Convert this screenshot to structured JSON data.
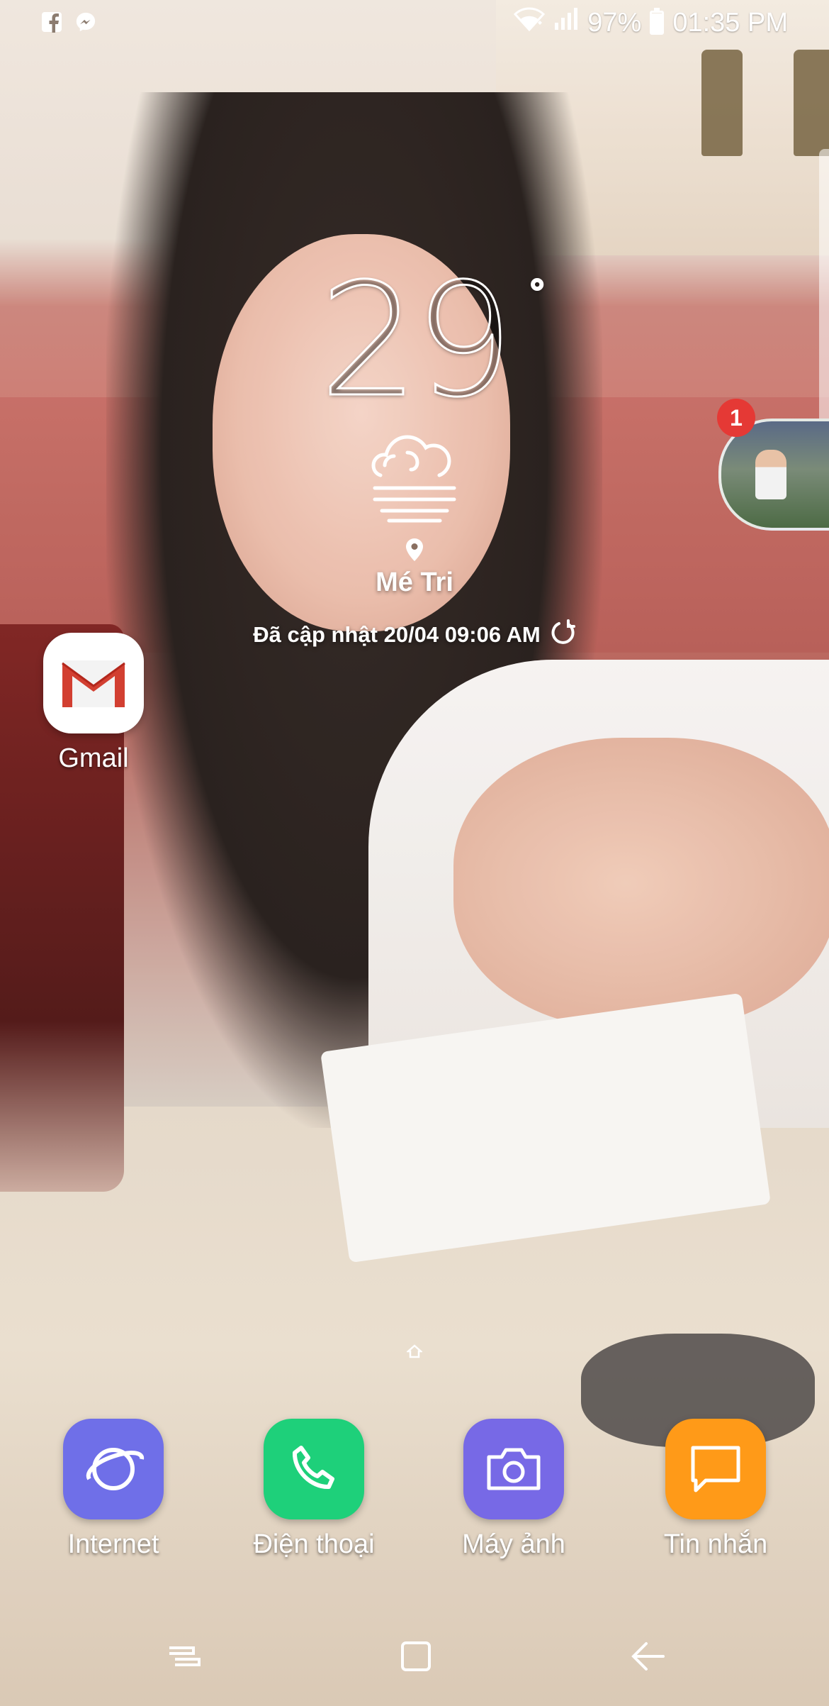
{
  "status_bar": {
    "notification_icons": [
      "facebook-icon",
      "messenger-icon"
    ],
    "signal_icons": [
      "wifi-icon",
      "cellular-signal-icon"
    ],
    "battery_percent": "97%",
    "battery_level": 0.97,
    "time": "01:35 PM"
  },
  "weather_widget": {
    "temperature": "29",
    "degree_symbol": "°",
    "condition_icon": "windy-cloud-icon",
    "location_icon": "location-pin-icon",
    "location": "Mé Tri",
    "updated_text": "Đã cập nhật 20/04 09:06 AM",
    "refresh_icon": "refresh-icon"
  },
  "floating_bubble": {
    "badge_count": "1"
  },
  "home_apps": [
    {
      "label": "Gmail",
      "icon": "gmail-icon",
      "color": "#ffffff"
    }
  ],
  "dock": [
    {
      "label": "Internet",
      "icon": "internet-planet-icon",
      "color": "#6f6fe8"
    },
    {
      "label": "Điện thoại",
      "icon": "phone-icon",
      "color": "#1ed07a"
    },
    {
      "label": "Máy ảnh",
      "icon": "camera-icon",
      "color": "#7769e6"
    },
    {
      "label": "Tin nhắn",
      "icon": "message-icon",
      "color": "#ff9a18"
    }
  ],
  "page_indicator": {
    "icon": "home-page-icon"
  },
  "nav_bar": {
    "buttons": [
      "recent-apps-icon",
      "home-icon",
      "back-icon"
    ]
  }
}
